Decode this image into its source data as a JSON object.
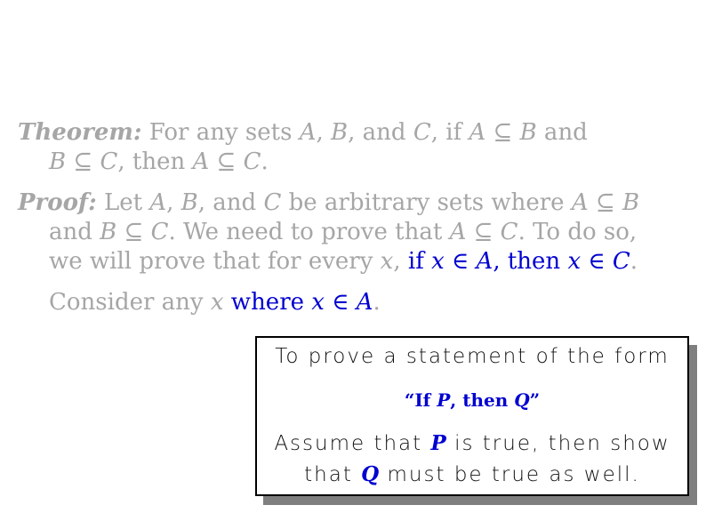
{
  "theorem": {
    "label": "Theorem:",
    "l1_a": " For any sets ",
    "A": "A",
    "comma1": ", ",
    "B": "B",
    "and_txt": ", and ",
    "C": "C",
    "if_txt": ", if ",
    "A2": "A",
    "subset1": " ⊆ ",
    "B2": "B",
    "and_end": " and",
    "B3": "B",
    "subset2": " ⊆ ",
    "C2": "C",
    "then_txt": ", then ",
    "A3": "A",
    "subset3": " ⊆ ",
    "C3": "C",
    "period": "."
  },
  "proof": {
    "label": "Proof:",
    "l1_a": " Let ",
    "A": "A",
    "c1": ", ",
    "B": "B",
    "c2": ", and ",
    "C": "C",
    "l1_b": " be arbitrary sets where ",
    "A2": "A",
    "sub1": " ⊆ ",
    "B2": "B",
    "l2_a": "and ",
    "B3": "B",
    "sub2": " ⊆ ",
    "C2": "C",
    "l2_b": ". We need to prove that ",
    "A3": "A",
    "sub3": " ⊆ ",
    "C3": "C",
    "l2_c": ". To do so,",
    "l3_a": "we will prove that for every ",
    "x": "x",
    "l3_comma": ", ",
    "if_word": "if ",
    "x2": "x",
    "in1": " ∈ ",
    "A4": "A",
    "then_word": ", then ",
    "x3": "x",
    "in2": " ∈ ",
    "C4": "C",
    "period": "."
  },
  "consider": {
    "t1": "Consider any ",
    "x": "x",
    "where": " where ",
    "x2": "x",
    "in": " ∈ ",
    "A": "A",
    "period": "."
  },
  "callout": {
    "line1": "To prove a statement of the form",
    "heading_open": "“If ",
    "heading_P": "P",
    "heading_mid": ", then ",
    "heading_Q": "Q",
    "heading_close": "”",
    "line3_a": "Assume that ",
    "line3_P": "P",
    "line3_b": " is true, then show",
    "line4_a": "that ",
    "line4_Q": "Q",
    "line4_b": " must be true as well."
  },
  "colors": {
    "faded_text": "#a6a6a6",
    "highlight_blue": "#0000d0",
    "shadow": "#7f7f7f"
  }
}
